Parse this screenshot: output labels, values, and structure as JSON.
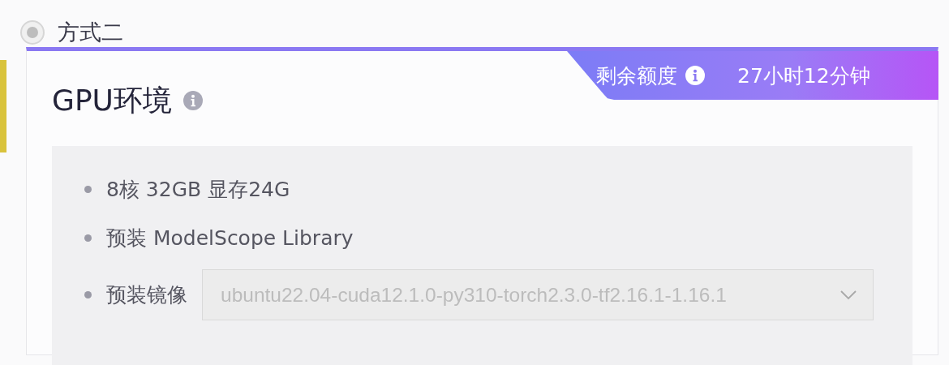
{
  "option": {
    "label": "方式二",
    "selected": true,
    "disabled": true
  },
  "card": {
    "title": "GPU环境",
    "quota": {
      "label": "剩余额度",
      "value": "27小时12分钟"
    },
    "specs": [
      {
        "kind": "text",
        "label": "8核 32GB 显存24G"
      },
      {
        "kind": "text",
        "label": "预装 ModelScope Library"
      },
      {
        "kind": "select",
        "label": "预装镜像",
        "value": "ubuntu22.04-cuda12.1.0-py310-torch2.3.0-tf2.16.1-1.16.1",
        "disabled": true
      }
    ]
  }
}
